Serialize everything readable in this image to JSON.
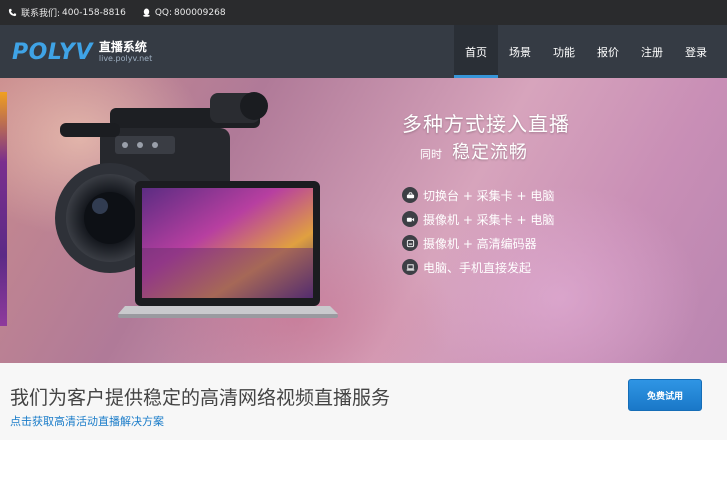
{
  "topbar": {
    "contact_label": "联系我们:",
    "phone": "400-158-8816",
    "qq_label": "QQ:",
    "qq": "800009268"
  },
  "brand": {
    "logo_text": "POLYV",
    "product_name": "直播系统",
    "url": "live.polyv.net",
    "accent_color": "#3fa3e6"
  },
  "nav": {
    "items": [
      {
        "label": "首页",
        "active": true
      },
      {
        "label": "场景"
      },
      {
        "label": "功能"
      },
      {
        "label": "报价"
      },
      {
        "label": "注册"
      },
      {
        "label": "登录"
      }
    ]
  },
  "banner": {
    "headline": "多种方式接入直播",
    "sub_small": "同时",
    "sub_big": "稳定流畅",
    "features": [
      {
        "icon": "switcher-icon",
        "text": "切换台 + 采集卡 + 电脑"
      },
      {
        "icon": "camera-icon",
        "text": "摄像机 + 采集卡 + 电脑"
      },
      {
        "icon": "encoder-icon",
        "text": "摄像机 + 高清编码器"
      },
      {
        "icon": "laptop-icon",
        "text": "电脑、手机直接发起"
      }
    ]
  },
  "cta": {
    "title": "我们为客户提供稳定的高清网络视频直播服务",
    "link": "点击获取高清活动直播解决方案",
    "button": "免费试用",
    "button_color": "#2a8ad8"
  }
}
